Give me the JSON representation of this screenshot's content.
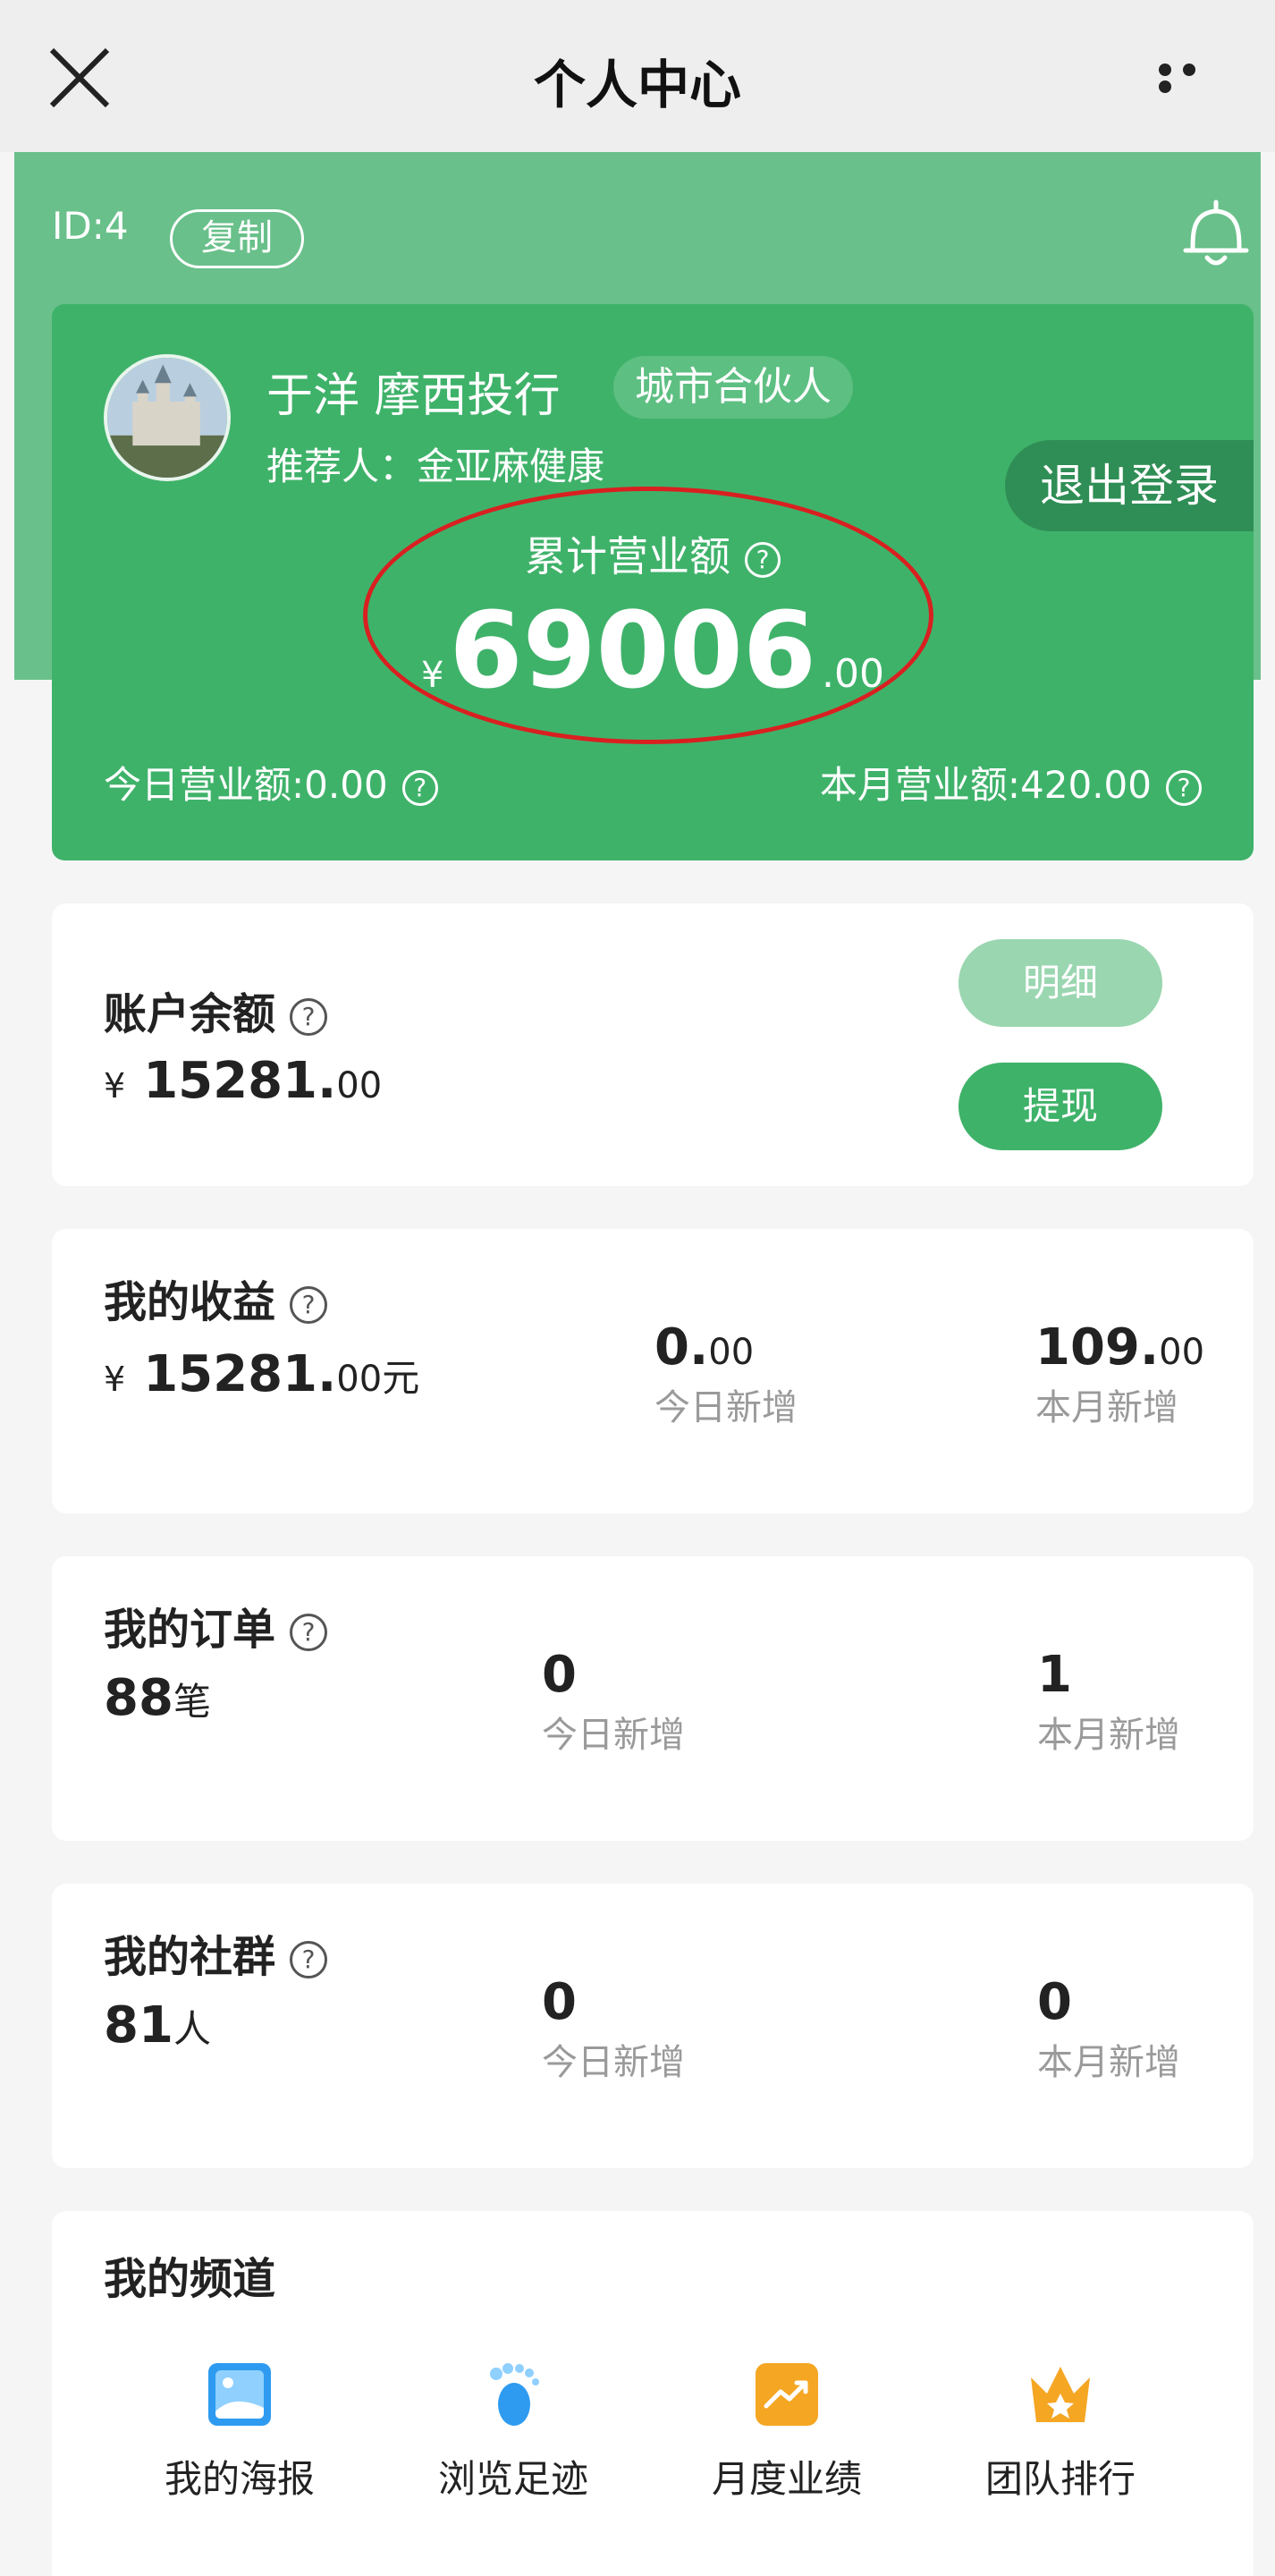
{
  "topbar": {
    "title": "个人中心"
  },
  "header": {
    "id_label": "ID:4",
    "copy_label": "复制",
    "name": "于洋 摩西投行",
    "role_badge": "城市合伙人",
    "referrer": "推荐人：金亚麻健康",
    "logout_label": "退出登录",
    "total_label": "累计营业额",
    "total_currency": "¥",
    "total_int": "69006",
    "total_dec": ".00",
    "today_revenue": "今日营业额:0.00",
    "month_revenue": "本月营业额:420.00"
  },
  "balance": {
    "title": "账户余额",
    "currency": "¥",
    "int": "15281.",
    "dec": "00",
    "detail_label": "明细",
    "withdraw_label": "提现"
  },
  "earnings": {
    "title": "我的收益",
    "currency": "¥",
    "int": "15281.",
    "dec": "00",
    "unit": "元",
    "today_value_int": "0.",
    "today_value_dec": "00",
    "today_label": "今日新增",
    "month_value_int": "109.",
    "month_value_dec": "00",
    "month_label": "本月新增"
  },
  "orders": {
    "title": "我的订单",
    "count": "88",
    "unit": "笔",
    "today_value": "0",
    "today_label": "今日新增",
    "month_value": "1",
    "month_label": "本月新增"
  },
  "community": {
    "title": "我的社群",
    "count": "81",
    "unit": "人",
    "today_value": "0",
    "today_label": "今日新增",
    "month_value": "0",
    "month_label": "本月新增"
  },
  "channels": {
    "title": "我的频道",
    "items": [
      {
        "label": "我的海报",
        "icon": "poster-icon",
        "color": "#2e9bf0"
      },
      {
        "label": "浏览足迹",
        "icon": "footprint-icon",
        "color": "#2e9bf0"
      },
      {
        "label": "月度业绩",
        "icon": "trend-chart-icon",
        "color": "#f5a623"
      },
      {
        "label": "团队排行",
        "icon": "crown-icon",
        "color": "#f5a623"
      }
    ]
  },
  "colors": {
    "primary_green": "#3fb26a",
    "header_green": "#69c08a",
    "annotation_red": "#d92020"
  }
}
